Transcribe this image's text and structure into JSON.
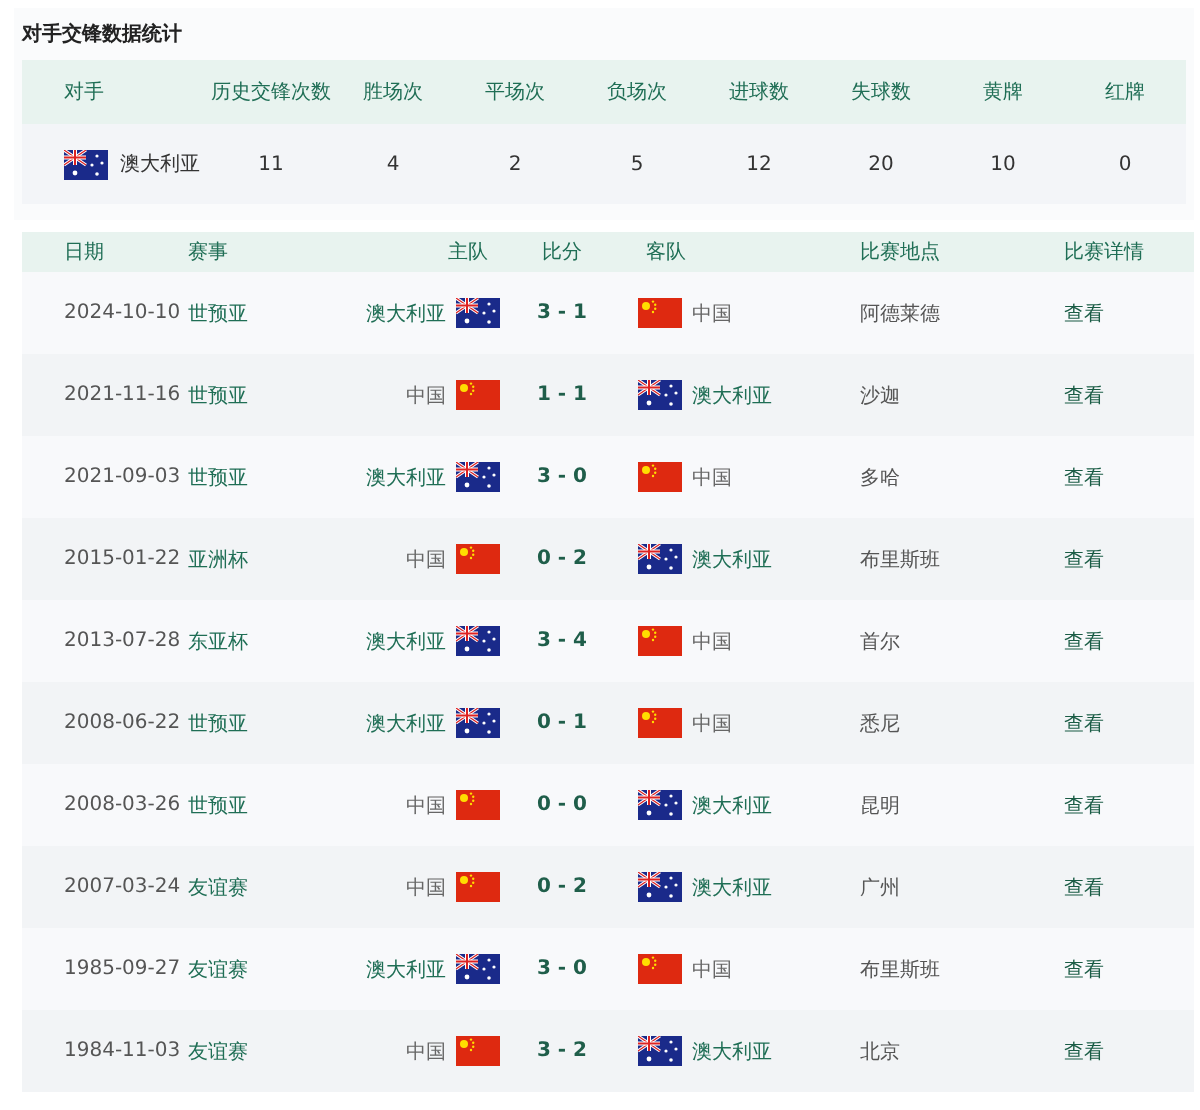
{
  "title": "对手交锋数据统计",
  "summary": {
    "columns": [
      "对手",
      "历史交锋次数",
      "胜场次",
      "平场次",
      "负场次",
      "进球数",
      "失球数",
      "黄牌",
      "红牌"
    ],
    "row": {
      "opponent": {
        "name": "澳大利亚",
        "kind": "australia"
      },
      "values": [
        "11",
        "4",
        "2",
        "5",
        "12",
        "20",
        "10",
        "0"
      ]
    }
  },
  "matches": {
    "columns": [
      "日期",
      "赛事",
      "主队",
      "比分",
      "客队",
      "比赛地点",
      "比赛详情"
    ],
    "rows": [
      {
        "date": "2024-10-10",
        "event": "世预亚",
        "home": {
          "name": "澳大利亚",
          "kind": "australia",
          "highlighted": true
        },
        "score": "3 - 1",
        "away": {
          "name": "中国",
          "kind": "china",
          "highlighted": false
        },
        "venue": "阿德莱德",
        "detail": "查看"
      },
      {
        "date": "2021-11-16",
        "event": "世预亚",
        "home": {
          "name": "中国",
          "kind": "china",
          "highlighted": false
        },
        "score": "1 - 1",
        "away": {
          "name": "澳大利亚",
          "kind": "australia",
          "highlighted": true
        },
        "venue": "沙迦",
        "detail": "查看"
      },
      {
        "date": "2021-09-03",
        "event": "世预亚",
        "home": {
          "name": "澳大利亚",
          "kind": "australia",
          "highlighted": true
        },
        "score": "3 - 0",
        "away": {
          "name": "中国",
          "kind": "china",
          "highlighted": false
        },
        "venue": "多哈",
        "detail": "查看"
      },
      {
        "date": "2015-01-22",
        "event": "亚洲杯",
        "home": {
          "name": "中国",
          "kind": "china",
          "highlighted": false
        },
        "score": "0 - 2",
        "away": {
          "name": "澳大利亚",
          "kind": "australia",
          "highlighted": true
        },
        "venue": "布里斯班",
        "detail": "查看"
      },
      {
        "date": "2013-07-28",
        "event": "东亚杯",
        "home": {
          "name": "澳大利亚",
          "kind": "australia",
          "highlighted": true
        },
        "score": "3 - 4",
        "away": {
          "name": "中国",
          "kind": "china",
          "highlighted": false
        },
        "venue": "首尔",
        "detail": "查看"
      },
      {
        "date": "2008-06-22",
        "event": "世预亚",
        "home": {
          "name": "澳大利亚",
          "kind": "australia",
          "highlighted": true
        },
        "score": "0 - 1",
        "away": {
          "name": "中国",
          "kind": "china",
          "highlighted": false
        },
        "venue": "悉尼",
        "detail": "查看"
      },
      {
        "date": "2008-03-26",
        "event": "世预亚",
        "home": {
          "name": "中国",
          "kind": "china",
          "highlighted": false
        },
        "score": "0 - 0",
        "away": {
          "name": "澳大利亚",
          "kind": "australia",
          "highlighted": true
        },
        "venue": "昆明",
        "detail": "查看"
      },
      {
        "date": "2007-03-24",
        "event": "友谊赛",
        "home": {
          "name": "中国",
          "kind": "china",
          "highlighted": false
        },
        "score": "0 - 2",
        "away": {
          "name": "澳大利亚",
          "kind": "australia",
          "highlighted": true
        },
        "venue": "广州",
        "detail": "查看"
      },
      {
        "date": "1985-09-27",
        "event": "友谊赛",
        "home": {
          "name": "澳大利亚",
          "kind": "australia",
          "highlighted": true
        },
        "score": "3 - 0",
        "away": {
          "name": "中国",
          "kind": "china",
          "highlighted": false
        },
        "venue": "布里斯班",
        "detail": "查看"
      },
      {
        "date": "1984-11-03",
        "event": "友谊赛",
        "home": {
          "name": "中国",
          "kind": "china",
          "highlighted": false
        },
        "score": "3 - 2",
        "away": {
          "name": "澳大利亚",
          "kind": "australia",
          "highlighted": true
        },
        "venue": "北京",
        "detail": "查看"
      }
    ]
  }
}
